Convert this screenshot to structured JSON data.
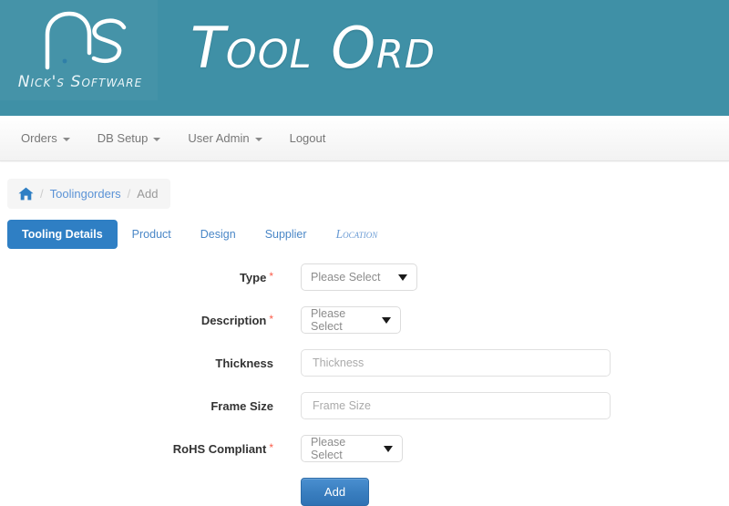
{
  "brand": {
    "logo_mark": "ns-monogram-logo",
    "logo_caption": "Nick's Software",
    "title": "Tool Ord",
    "header_color": "#3f90a6"
  },
  "navbar": {
    "items": [
      {
        "label": "Orders",
        "has_caret": true
      },
      {
        "label": "DB Setup",
        "has_caret": true
      },
      {
        "label": "User Admin",
        "has_caret": true
      },
      {
        "label": "Logout",
        "has_caret": false
      }
    ]
  },
  "breadcrumb": {
    "home_icon": "home-icon",
    "sep1": "/",
    "sep2": "/",
    "parent": "Toolingorders",
    "current": "Add"
  },
  "tabs": {
    "items": [
      {
        "label": "Tooling Details",
        "active": true
      },
      {
        "label": "Product",
        "active": false
      },
      {
        "label": "Design",
        "active": false
      },
      {
        "label": "Supplier",
        "active": false
      },
      {
        "label": "Location",
        "active": false
      }
    ],
    "active_color": "#2f7fc4",
    "link_color": "#4a87c7"
  },
  "form": {
    "required_marker": "*",
    "fields": [
      {
        "label": "Type",
        "required": true,
        "type": "select",
        "value": "Please Select"
      },
      {
        "label": "Description",
        "required": true,
        "type": "select",
        "value": "Please Select"
      },
      {
        "label": "Thickness",
        "required": false,
        "type": "text",
        "value": "",
        "placeholder": "Thickness"
      },
      {
        "label": "Frame Size",
        "required": false,
        "type": "text",
        "value": "",
        "placeholder": "Frame Size"
      },
      {
        "label": "RoHS Compliant",
        "required": true,
        "type": "select",
        "value": "Please Select"
      }
    ],
    "submit_label": "Add",
    "submit_color": "#3a7fc0"
  }
}
